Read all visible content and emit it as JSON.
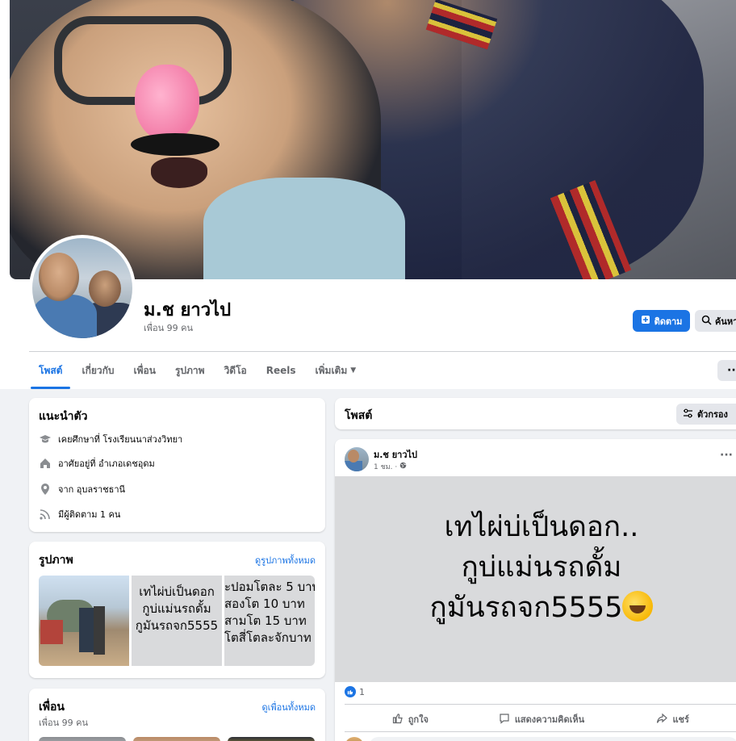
{
  "profile": {
    "name": "ม.ช ยาวไป",
    "friends_count": "เพื่อน 99 คน"
  },
  "actions": {
    "follow_label": "ติดตาม",
    "search_label": "ค้นหา"
  },
  "tabs": [
    {
      "label": "โพสต์",
      "active": true
    },
    {
      "label": "เกี่ยวกับ"
    },
    {
      "label": "เพื่อน"
    },
    {
      "label": "รูปภาพ"
    },
    {
      "label": "วิดีโอ"
    },
    {
      "label": "Reels"
    },
    {
      "label": "เพิ่มเติม"
    }
  ],
  "more_button": "···",
  "intro": {
    "title": "แนะนำตัว",
    "items": [
      {
        "icon": "graduation-cap-icon",
        "text": "เคยศึกษาที่ โรงเรียนนาส่วงวิทยา"
      },
      {
        "icon": "home-icon",
        "text": "อาศัยอยู่ที่ อำเภอเดชอุดม"
      },
      {
        "icon": "location-pin-icon",
        "text": "จาก อุบลราชธานี"
      },
      {
        "icon": "rss-icon",
        "text": "มีผู้ติดตาม 1 คน"
      }
    ]
  },
  "photos": {
    "title": "รูปภาพ",
    "see_all": "ดูรูปภาพทั้งหมด",
    "thumb2_lines": [
      "เทไผ่บ่เป็นดอก",
      "กูบ่แม่นรถดั้ม",
      "กูมันรถจก5555"
    ],
    "thumb3_lines": [
      "ะปอมโตละ 5 บาท",
      "สองโต 10 บาท",
      "สามโต 15 บาท",
      "โตสี่โตละจักบาท"
    ]
  },
  "friends": {
    "title": "เพื่อน",
    "see_all": "ดูเพื่อนทั้งหมด",
    "count": "เพื่อน 99 คน"
  },
  "posts_section": {
    "title": "โพสต์",
    "filter_label": "ตัวกรอง"
  },
  "post": {
    "author": "ม.ช ยาวไป",
    "time": "1 ชม. ·",
    "image_lines": [
      "เทไผ่บ่เป็นดอก..",
      "กูบ่แม่นรถดั้ม",
      "กูมันรถจก5555"
    ],
    "emoji": "rolling-on-floor-laughing-emoji",
    "like_count": "1",
    "like_label": "ถูกใจ",
    "comment_label": "แสดงความคิดเห็น",
    "share_label": "แชร์"
  },
  "colors": {
    "accent": "#1b74e4",
    "page_bg": "#f0f2f5",
    "secondary_text": "#65676b"
  }
}
